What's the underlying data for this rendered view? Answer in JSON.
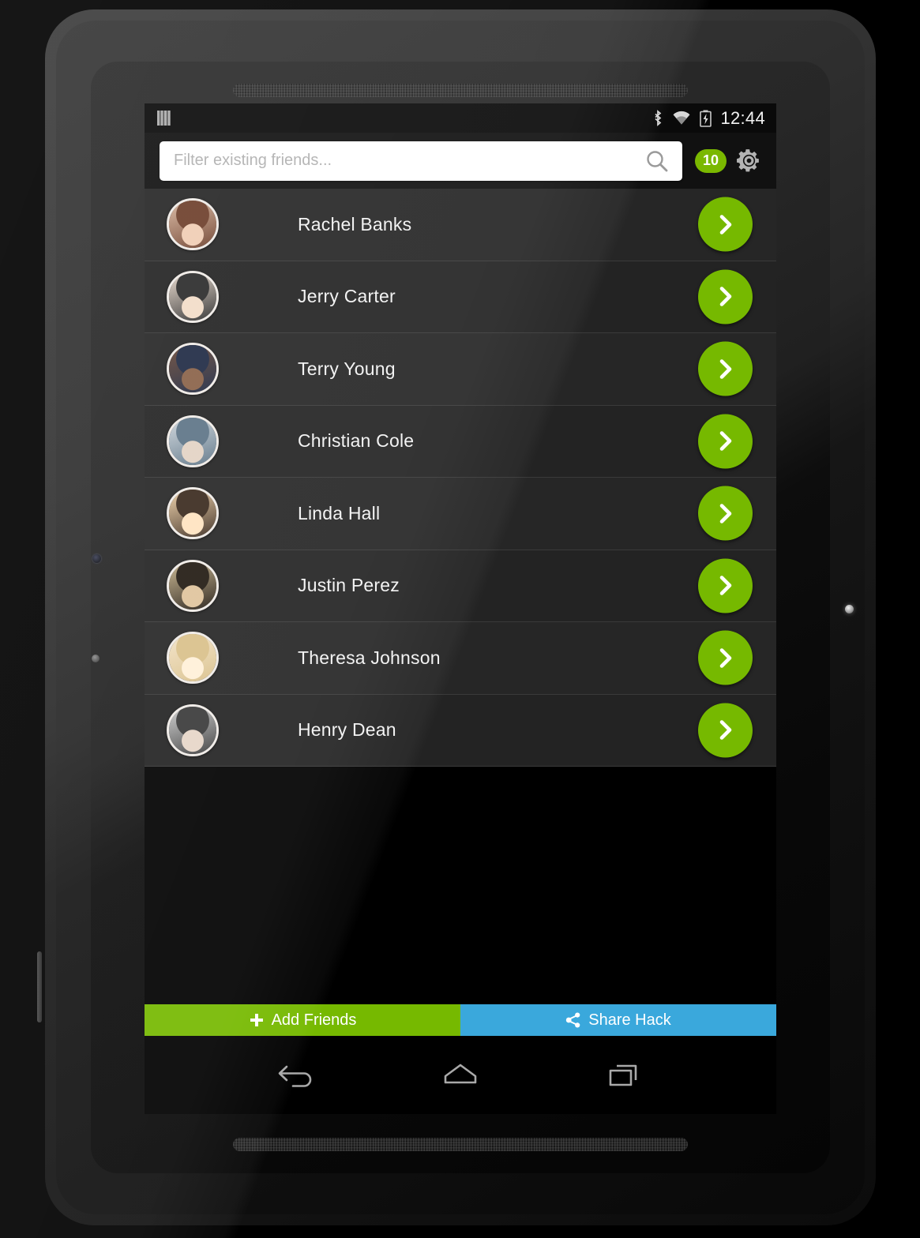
{
  "status_bar": {
    "left_icon": "app-notification-icon",
    "bluetooth_icon": "bluetooth-icon",
    "wifi_icon": "wifi-icon",
    "battery_icon": "battery-charging-icon",
    "clock": "12:44"
  },
  "header": {
    "search_placeholder": "Filter existing friends...",
    "search_value": "",
    "search_icon": "search-icon",
    "badge_count": "10",
    "badge_color": "#7ab800",
    "settings_icon": "gear-icon"
  },
  "friends": [
    {
      "name": "Rachel Banks",
      "avatar": "avatar-photo",
      "action_icon": "chevron-right-icon"
    },
    {
      "name": "Jerry Carter",
      "avatar": "avatar-photo",
      "action_icon": "chevron-right-icon"
    },
    {
      "name": "Terry Young",
      "avatar": "avatar-photo",
      "action_icon": "chevron-right-icon"
    },
    {
      "name": "Christian Cole",
      "avatar": "avatar-photo",
      "action_icon": "chevron-right-icon"
    },
    {
      "name": "Linda Hall",
      "avatar": "avatar-photo",
      "action_icon": "chevron-right-icon"
    },
    {
      "name": "Justin Perez",
      "avatar": "avatar-photo",
      "action_icon": "chevron-right-icon"
    },
    {
      "name": "Theresa Johnson",
      "avatar": "avatar-photo",
      "action_icon": "chevron-right-icon"
    },
    {
      "name": "Henry Dean",
      "avatar": "avatar-photo",
      "action_icon": "chevron-right-icon"
    }
  ],
  "actions": {
    "add_friends_label": "Add Friends",
    "add_friends_icon": "plus-icon",
    "add_friends_color": "#76b900",
    "share_label": "Share Hack",
    "share_icon": "share-icon",
    "share_color": "#3aa8dc"
  },
  "nav_bar": {
    "back_icon": "back-arrow-icon",
    "home_icon": "home-icon",
    "recents_icon": "recent-apps-icon"
  },
  "theme": {
    "accent_green": "#76b900",
    "accent_blue": "#3aa8dc",
    "row_background": "#262626",
    "screen_background": "#000000"
  }
}
